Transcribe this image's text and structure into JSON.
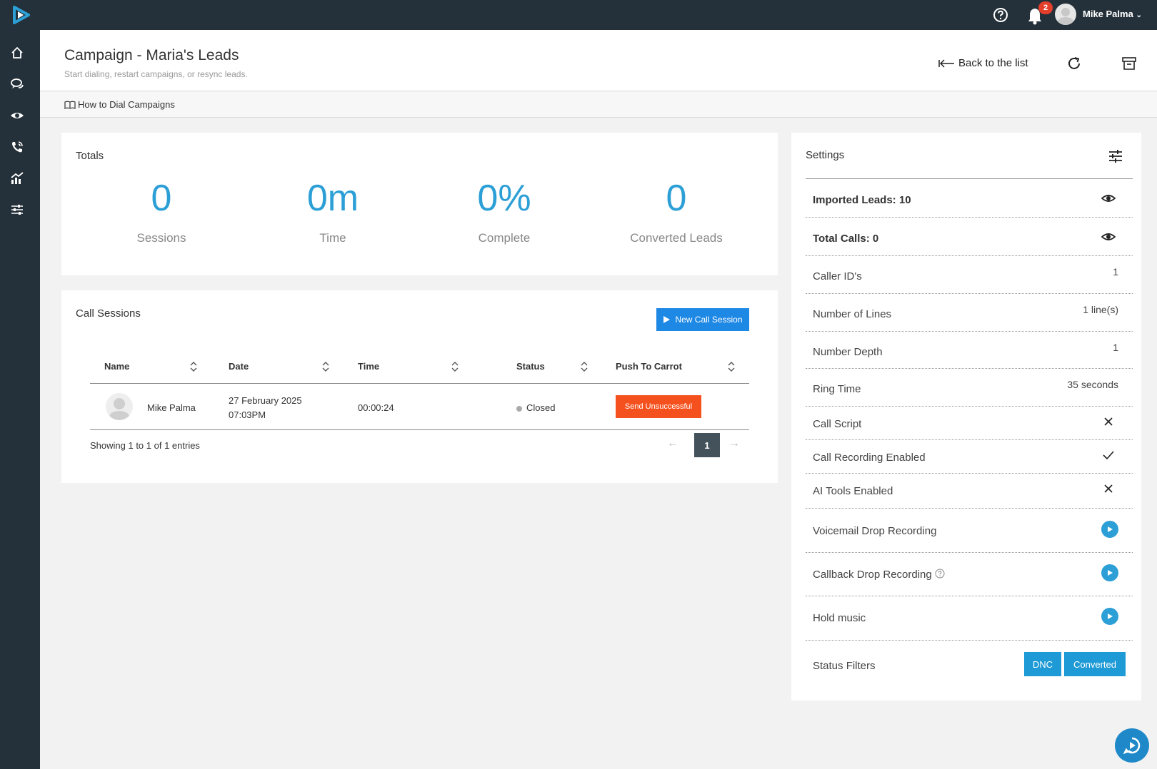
{
  "topbar": {
    "notification_count": "2",
    "user_name": "Mike Palma"
  },
  "header": {
    "title": "Campaign - Maria's Leads",
    "subtitle": "Start dialing, restart campaigns, or resync leads.",
    "back_label": "Back to the list",
    "howto_label": "How to Dial Campaigns"
  },
  "totals": {
    "title": "Totals",
    "stats": [
      {
        "value": "0",
        "label": "Sessions"
      },
      {
        "value": "0m",
        "label": "Time"
      },
      {
        "value": "0%",
        "label": "Complete"
      },
      {
        "value": "0",
        "label": "Converted Leads"
      }
    ]
  },
  "sessions": {
    "title": "Call Sessions",
    "new_button": "New Call Session",
    "columns": [
      "Name",
      "Date",
      "Time",
      "Status",
      "Push To Carrot"
    ],
    "rows": [
      {
        "name": "Mike Palma",
        "date_line1": "27 February 2025",
        "date_line2": "07:03PM",
        "time": "00:00:24",
        "status": "Closed",
        "action": "Send Unsuccessful"
      }
    ],
    "entries_text": "Showing 1 to 1 of 1 entries",
    "prev": "←",
    "page": "1",
    "next": "→"
  },
  "settings": {
    "title": "Settings",
    "imported_leads": "Imported Leads: 10",
    "total_calls": "Total Calls: 0",
    "caller_ids_label": "Caller ID's",
    "caller_ids_value": "1",
    "lines_label": "Number of Lines",
    "lines_value": "1 line(s)",
    "depth_label": "Number Depth",
    "depth_value": "1",
    "ring_label": "Ring Time",
    "ring_value": "35 seconds",
    "script_label": "Call Script",
    "recording_label": "Call Recording Enabled",
    "ai_label": "AI Tools Enabled",
    "voicemail_label": "Voicemail Drop Recording",
    "callback_label": "Callback Drop Recording",
    "hold_label": "Hold music",
    "filters_label": "Status Filters",
    "filter_dnc": "DNC",
    "filter_converted": "Converted"
  },
  "colors": {
    "accent": "#2c9fd6",
    "topbar": "#25313a",
    "danger": "#f5511e"
  }
}
